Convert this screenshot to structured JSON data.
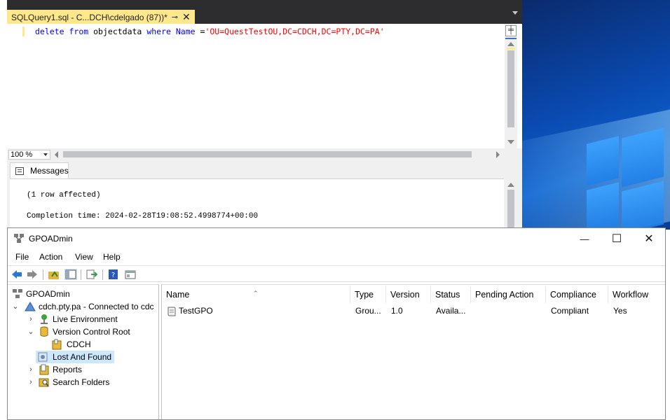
{
  "ssms": {
    "tab_title": "SQLQuery1.sql - C...DCH\\cdelgado (87))*",
    "pin_glyph": "⊸",
    "close_glyph": "✕",
    "code": {
      "kw1": "delete",
      "kw2": "from",
      "table": "objectdata",
      "kw3": "where",
      "column": "Name",
      "op": "=",
      "literal": "'OU=QuestTestOU,DC=CDCH,DC=PTY,DC=PA'"
    },
    "zoom": "100 %",
    "results_tab": "Messages",
    "messages": [
      "(1 row affected)",
      "Completion time: 2024-02-28T19:08:52.4998774+00:00"
    ]
  },
  "gpo": {
    "title": "GPOADmin",
    "window_controls": {
      "minimize": "—",
      "maximize": "☐",
      "close": "✕"
    },
    "menu": [
      "File",
      "Action",
      "View",
      "Help"
    ],
    "tree": {
      "root": "GPOADmin",
      "domain": "cdch.pty.pa - Connected to cdc",
      "live": "Live Environment",
      "vcr": "Version Control Root",
      "cdch": "CDCH",
      "lost": "Lost And Found",
      "reports": "Reports",
      "search": "Search Folders"
    },
    "columns": [
      "Name",
      "Type",
      "Version",
      "Status",
      "Pending Action",
      "Compliance",
      "Workflow"
    ],
    "rows": [
      {
        "name": "TestGPO",
        "type": "Grou...",
        "version": "1.0",
        "status": "Availa...",
        "pending": "",
        "compliance": "Compliant",
        "workflow": "Yes"
      }
    ]
  },
  "colors": {
    "ssms_tab": "#ffe88c",
    "ssms_chrome": "#2d2d30",
    "selection": "#cce8ff",
    "keyword": "#0000ff",
    "string": "#ff0000"
  }
}
